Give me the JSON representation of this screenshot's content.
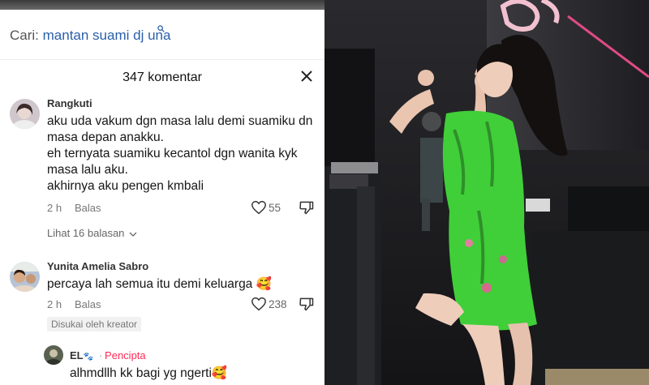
{
  "search": {
    "prefix": "Cari: ",
    "query": "mantan suami dj una"
  },
  "header": {
    "count": "347 komentar"
  },
  "comments": [
    {
      "username": "Rangkuti",
      "lines": [
        "aku uda vakum dgn masa lalu demi suamiku dn",
        "masa depan anakku.",
        "eh ternyata suamiku kecantol dgn wanita kyk",
        "masa lalu aku.",
        "akhirnya aku pengen kmbali"
      ],
      "time": "2 h",
      "reply": "Balas",
      "likes": "55",
      "view_replies": "Lihat 16 balasan"
    },
    {
      "username": "Yunita Amelia Sabro",
      "text": "percaya lah semua itu demi keluarga",
      "emoji": "🥰",
      "time": "2 h",
      "reply": "Balas",
      "likes": "238",
      "badge": "Disukai oleh kreator"
    }
  ],
  "creator_reply": {
    "username": "EL",
    "username_emoji": "🐾",
    "separator": "·",
    "tag": "Pencipta",
    "text": "alhmdllh kk bagi yg ngerti",
    "emoji": "🥰"
  },
  "icons": [
    "search-icon",
    "close-icon",
    "heart-icon",
    "dislike-icon",
    "chevron-down-icon"
  ],
  "colors": {
    "link": "#2b5fa8",
    "creator_tag": "#fe2c55",
    "dress": "#3fcf38"
  }
}
